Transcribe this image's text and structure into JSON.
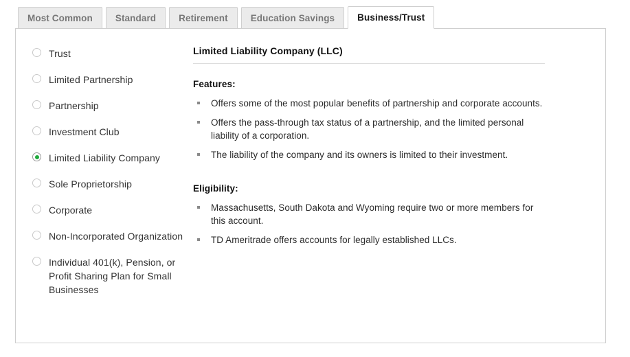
{
  "tabs": [
    {
      "label": "Most Common",
      "active": false
    },
    {
      "label": "Standard",
      "active": false
    },
    {
      "label": "Retirement",
      "active": false
    },
    {
      "label": "Education Savings",
      "active": false
    },
    {
      "label": "Business/Trust",
      "active": true
    }
  ],
  "account_types": [
    {
      "label": "Trust",
      "selected": false
    },
    {
      "label": "Limited Partnership",
      "selected": false
    },
    {
      "label": "Partnership",
      "selected": false
    },
    {
      "label": "Investment Club",
      "selected": false
    },
    {
      "label": "Limited Liability Company",
      "selected": true
    },
    {
      "label": "Sole Proprietorship",
      "selected": false
    },
    {
      "label": "Corporate",
      "selected": false
    },
    {
      "label": "Non-Incorporated Organization",
      "selected": false
    },
    {
      "label": "Individual 401(k), Pension, or Profit Sharing Plan for Small Businesses",
      "selected": false
    }
  ],
  "detail": {
    "title": "Limited Liability Company (LLC)",
    "features_heading": "Features:",
    "features": [
      "Offers some of the most popular benefits of partnership and corporate accounts.",
      "Offers the pass-through tax status of a partnership, and the limited personal liability of a corporation.",
      "The liability of the company and its owners is limited to their investment."
    ],
    "eligibility_heading": "Eligibility:",
    "eligibility": [
      "Massachusetts, South Dakota and Wyoming require two or more members for this account.",
      "TD Ameritrade offers accounts for legally established LLCs."
    ]
  },
  "colors": {
    "selected_radio": "#1faa3c",
    "tab_inactive_text": "#777777",
    "tab_active_text": "#1a1a1a",
    "border": "#cfcfcf",
    "rule": "#dddddd"
  }
}
